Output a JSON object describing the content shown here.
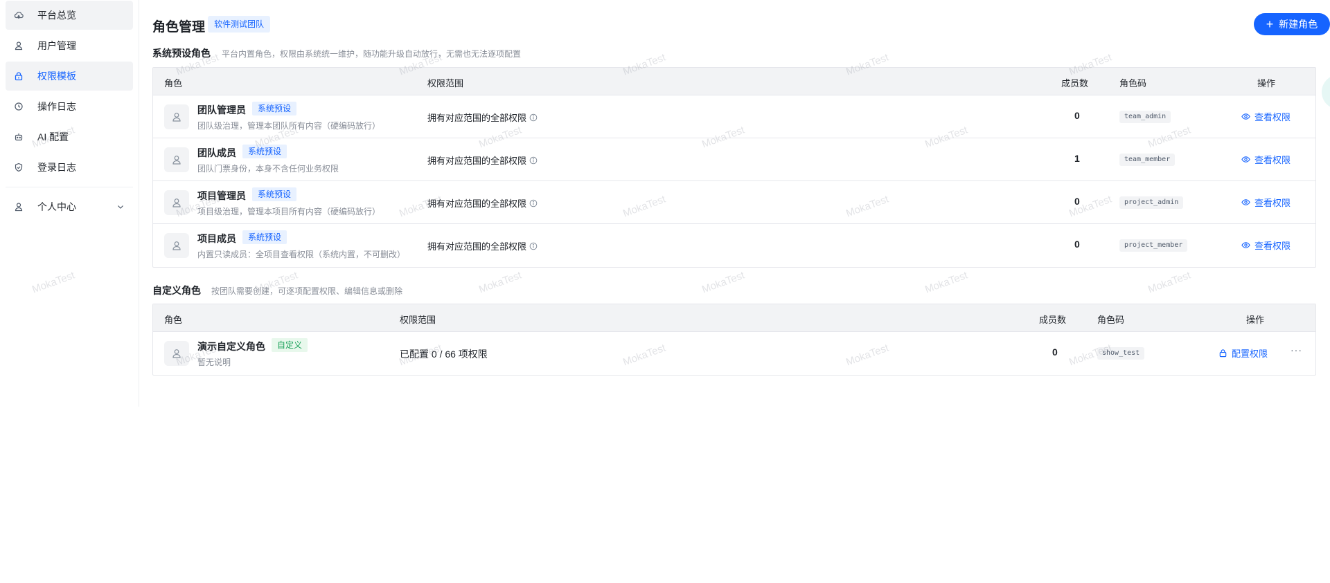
{
  "sidebar": {
    "items": [
      {
        "label": "平台总览",
        "icon": "cloud-icon",
        "state": "hover"
      },
      {
        "label": "用户管理",
        "icon": "user-icon",
        "state": ""
      },
      {
        "label": "权限模板",
        "icon": "lock-icon",
        "state": "active"
      },
      {
        "label": "操作日志",
        "icon": "history-icon",
        "state": ""
      },
      {
        "label": "AI 配置",
        "icon": "robot-icon",
        "state": ""
      },
      {
        "label": "登录日志",
        "icon": "shield-icon",
        "state": ""
      }
    ],
    "personal": {
      "label": "个人中心",
      "icon": "user-icon"
    }
  },
  "header": {
    "title": "角色管理",
    "team_tag": "软件测试团队",
    "new_button": "新建角色"
  },
  "system_section": {
    "title": "系统预设角色",
    "desc": "平台内置角色，权限由系统统一维护，随功能升级自动放行，无需也无法逐项配置",
    "columns": {
      "role": "角色",
      "scope": "权限范围",
      "members": "成员数",
      "code": "角色码",
      "actions": "操作"
    },
    "rows": [
      {
        "name": "团队管理员",
        "tag": "系统预设",
        "desc": "团队级治理，管理本团队所有内容（硬编码放行）",
        "scope": "拥有对应范围的全部权限",
        "members": "0",
        "code": "team_admin",
        "action": "查看权限"
      },
      {
        "name": "团队成员",
        "tag": "系统预设",
        "desc": "团队门票身份，本身不含任何业务权限",
        "scope": "拥有对应范围的全部权限",
        "members": "1",
        "code": "team_member",
        "action": "查看权限"
      },
      {
        "name": "项目管理员",
        "tag": "系统预设",
        "desc": "项目级治理，管理本项目所有内容（硬编码放行）",
        "scope": "拥有对应范围的全部权限",
        "members": "0",
        "code": "project_admin",
        "action": "查看权限"
      },
      {
        "name": "项目成员",
        "tag": "系统预设",
        "desc": "内置只读成员：全项目查看权限（系统内置，不可删改）",
        "scope": "拥有对应范围的全部权限",
        "members": "0",
        "code": "project_member",
        "action": "查看权限"
      }
    ]
  },
  "custom_section": {
    "title": "自定义角色",
    "desc": "按团队需要创建，可逐项配置权限、编辑信息或删除",
    "columns": {
      "role": "角色",
      "scope": "权限范围",
      "members": "成员数",
      "code": "角色码",
      "actions": "操作"
    },
    "rows": [
      {
        "name": "演示自定义角色",
        "tag": "自定义",
        "desc": "暂无说明",
        "scope": "已配置 0 / 66 项权限",
        "members": "0",
        "code": "show_test",
        "action": "配置权限",
        "more": "···"
      }
    ]
  },
  "watermark": "MokaTest",
  "colors": {
    "accent": "#1664ff",
    "custom_tag": "#18a058"
  }
}
